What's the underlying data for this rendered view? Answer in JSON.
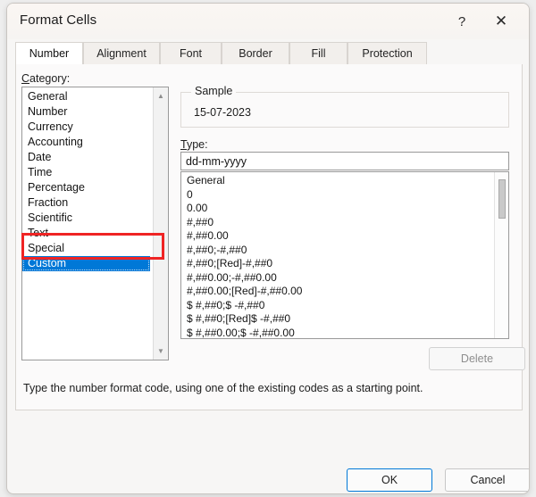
{
  "window": {
    "title": "Format Cells",
    "help_icon": "question-mark-icon",
    "close_icon": "close-x-icon",
    "help_glyph": "?",
    "close_glyph": "✕"
  },
  "tabs": [
    {
      "label": "Number",
      "active": true
    },
    {
      "label": "Alignment",
      "active": false
    },
    {
      "label": "Font",
      "active": false
    },
    {
      "label": "Border",
      "active": false
    },
    {
      "label": "Fill",
      "active": false
    },
    {
      "label": "Protection",
      "active": false
    }
  ],
  "category": {
    "label_prefix": "C",
    "label_rest": "ategory:",
    "items": [
      "General",
      "Number",
      "Currency",
      "Accounting",
      "Date",
      "Time",
      "Percentage",
      "Fraction",
      "Scientific",
      "Text",
      "Special",
      "Custom"
    ],
    "selected": "Custom",
    "scroll_up_glyph": "▲",
    "scroll_down_glyph": "▼"
  },
  "sample": {
    "legend": "Sample",
    "value": "15-07-2023"
  },
  "type": {
    "label_prefix": "T",
    "label_rest": "ype:",
    "value": "dd-mm-yyyy",
    "items": [
      "General",
      "0",
      "0.00",
      "#,##0",
      "#,##0.00",
      "#,##0;-#,##0",
      "#,##0;[Red]-#,##0",
      "#,##0.00;-#,##0.00",
      "#,##0.00;[Red]-#,##0.00",
      "$ #,##0;$ -#,##0",
      "$ #,##0;[Red]$ -#,##0",
      "$ #,##0.00;$ -#,##0.00"
    ]
  },
  "buttons": {
    "delete": "Delete",
    "ok": "OK",
    "cancel": "Cancel"
  },
  "hint": "Type the number format code, using one of the existing codes as a starting point.",
  "colors": {
    "selection_blue": "#0078d7",
    "annotation_red": "#ef2424",
    "dialog_background": "#f7f6f5"
  }
}
